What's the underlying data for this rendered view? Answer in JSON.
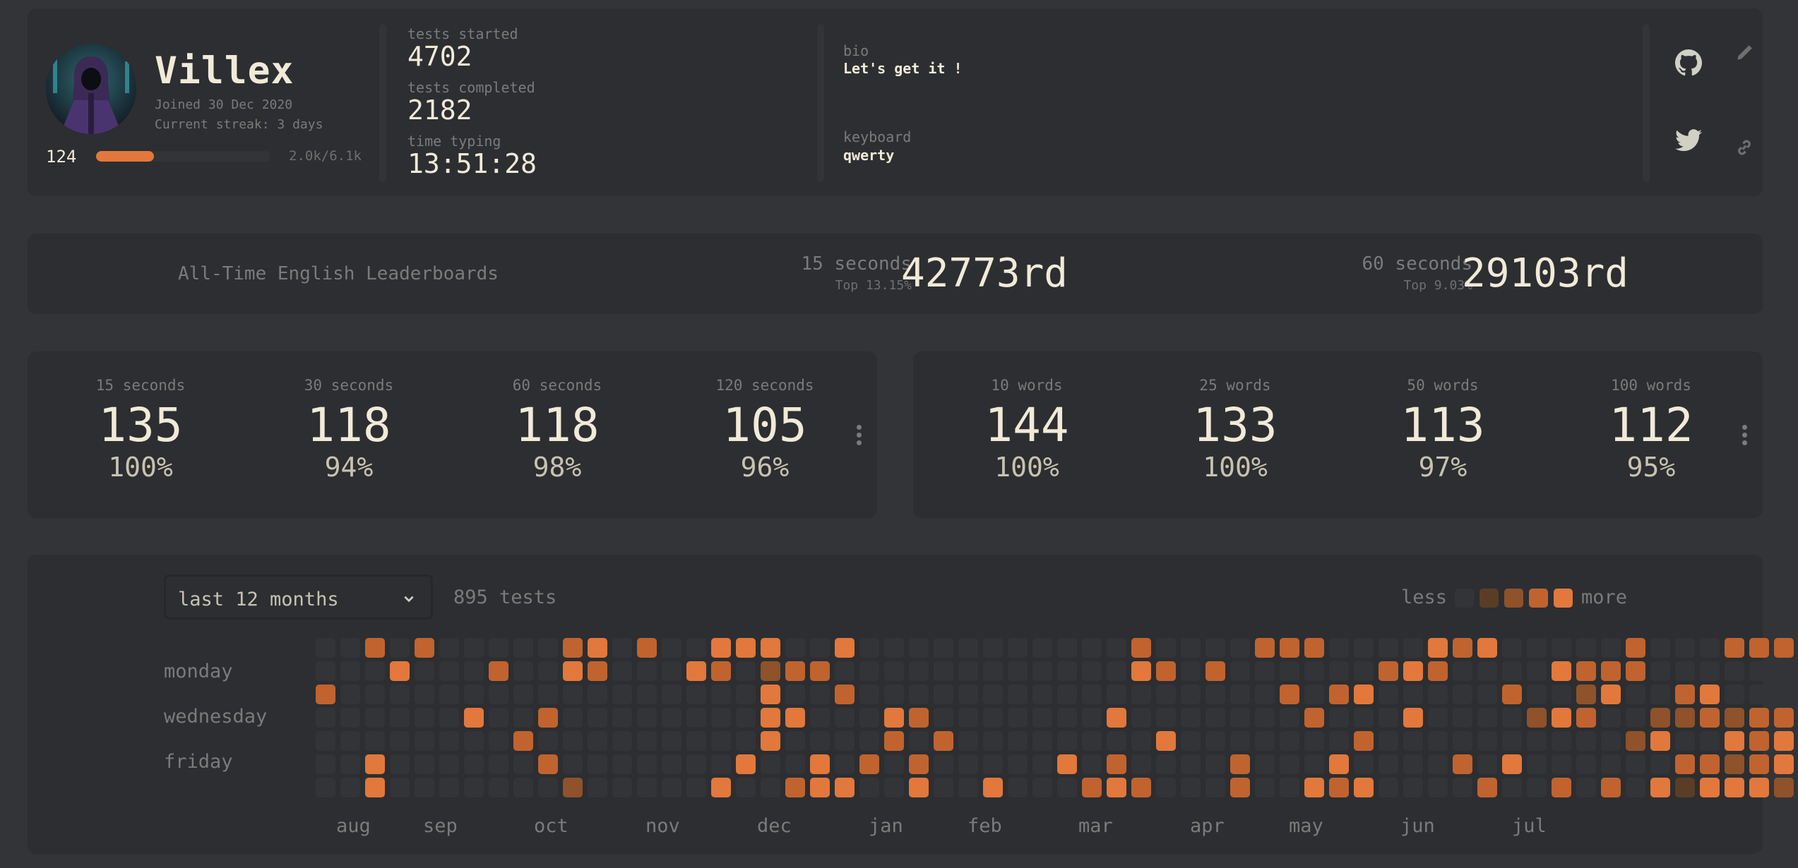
{
  "profile": {
    "username": "Villex",
    "joined": "Joined 30 Dec 2020",
    "streak": "Current streak: 3 days",
    "level": "124",
    "xp_text": "2.0k/6.1k",
    "xp_progress": 0.33
  },
  "stats": {
    "tests_started_label": "tests started",
    "tests_started": "4702",
    "tests_completed_label": "tests completed",
    "tests_completed": "2182",
    "time_typing_label": "time typing",
    "time_typing": "13:51:28"
  },
  "details": {
    "bio_label": "bio",
    "bio": "Let's get it !",
    "keyboard_label": "keyboard",
    "keyboard": "qwerty"
  },
  "icons": {
    "github": "github-icon",
    "twitter": "twitter-icon",
    "edit": "pencil-icon",
    "link": "link-icon"
  },
  "leaderboards": {
    "title": "All-Time English Leaderboards",
    "entries": [
      {
        "mode": "15 seconds",
        "top": "Top 13.15%",
        "rank": "42773rd"
      },
      {
        "mode": "60 seconds",
        "top": "Top 9.03%",
        "rank": "29103rd"
      }
    ]
  },
  "personal_bests": {
    "time": [
      {
        "mode": "15 seconds",
        "wpm": "135",
        "acc": "100%"
      },
      {
        "mode": "30 seconds",
        "wpm": "118",
        "acc": "94%"
      },
      {
        "mode": "60 seconds",
        "wpm": "118",
        "acc": "98%"
      },
      {
        "mode": "120 seconds",
        "wpm": "105",
        "acc": "96%"
      }
    ],
    "words": [
      {
        "mode": "10 words",
        "wpm": "144",
        "acc": "100%"
      },
      {
        "mode": "25 words",
        "wpm": "133",
        "acc": "100%"
      },
      {
        "mode": "50 words",
        "wpm": "113",
        "acc": "97%"
      },
      {
        "mode": "100 words",
        "wpm": "112",
        "acc": "95%"
      }
    ]
  },
  "activity": {
    "range": "last 12 months",
    "test_count": "895 tests",
    "legend_less": "less",
    "legend_more": "more",
    "day_labels": [
      "monday",
      "wednesday",
      "friday"
    ],
    "months": [
      "aug",
      "sep",
      "oct",
      "nov",
      "dec",
      "jan",
      "feb",
      "mar",
      "apr",
      "may",
      "jun",
      "jul"
    ],
    "level_colors": [
      "#323437",
      "#5a3d26",
      "#8f522a",
      "#c0632f",
      "#e2783b"
    ],
    "grid": [
      "0030300000340300444004000000000003000033300004340000030003334",
      "0004000300430004302330000000000004303000000343000043330000003",
      "3000000000000000004003000000000000000003034000003002400340000",
      "0000004003000000004400043000000040000000300040000243002232334",
      "0000000030000000004000030300000000400000003000000000024004343",
      "0040000003000000040040303000004030000300040000304000000332343",
      "0040000000200000400344004004000343000300434000030030304144420"
    ]
  }
}
